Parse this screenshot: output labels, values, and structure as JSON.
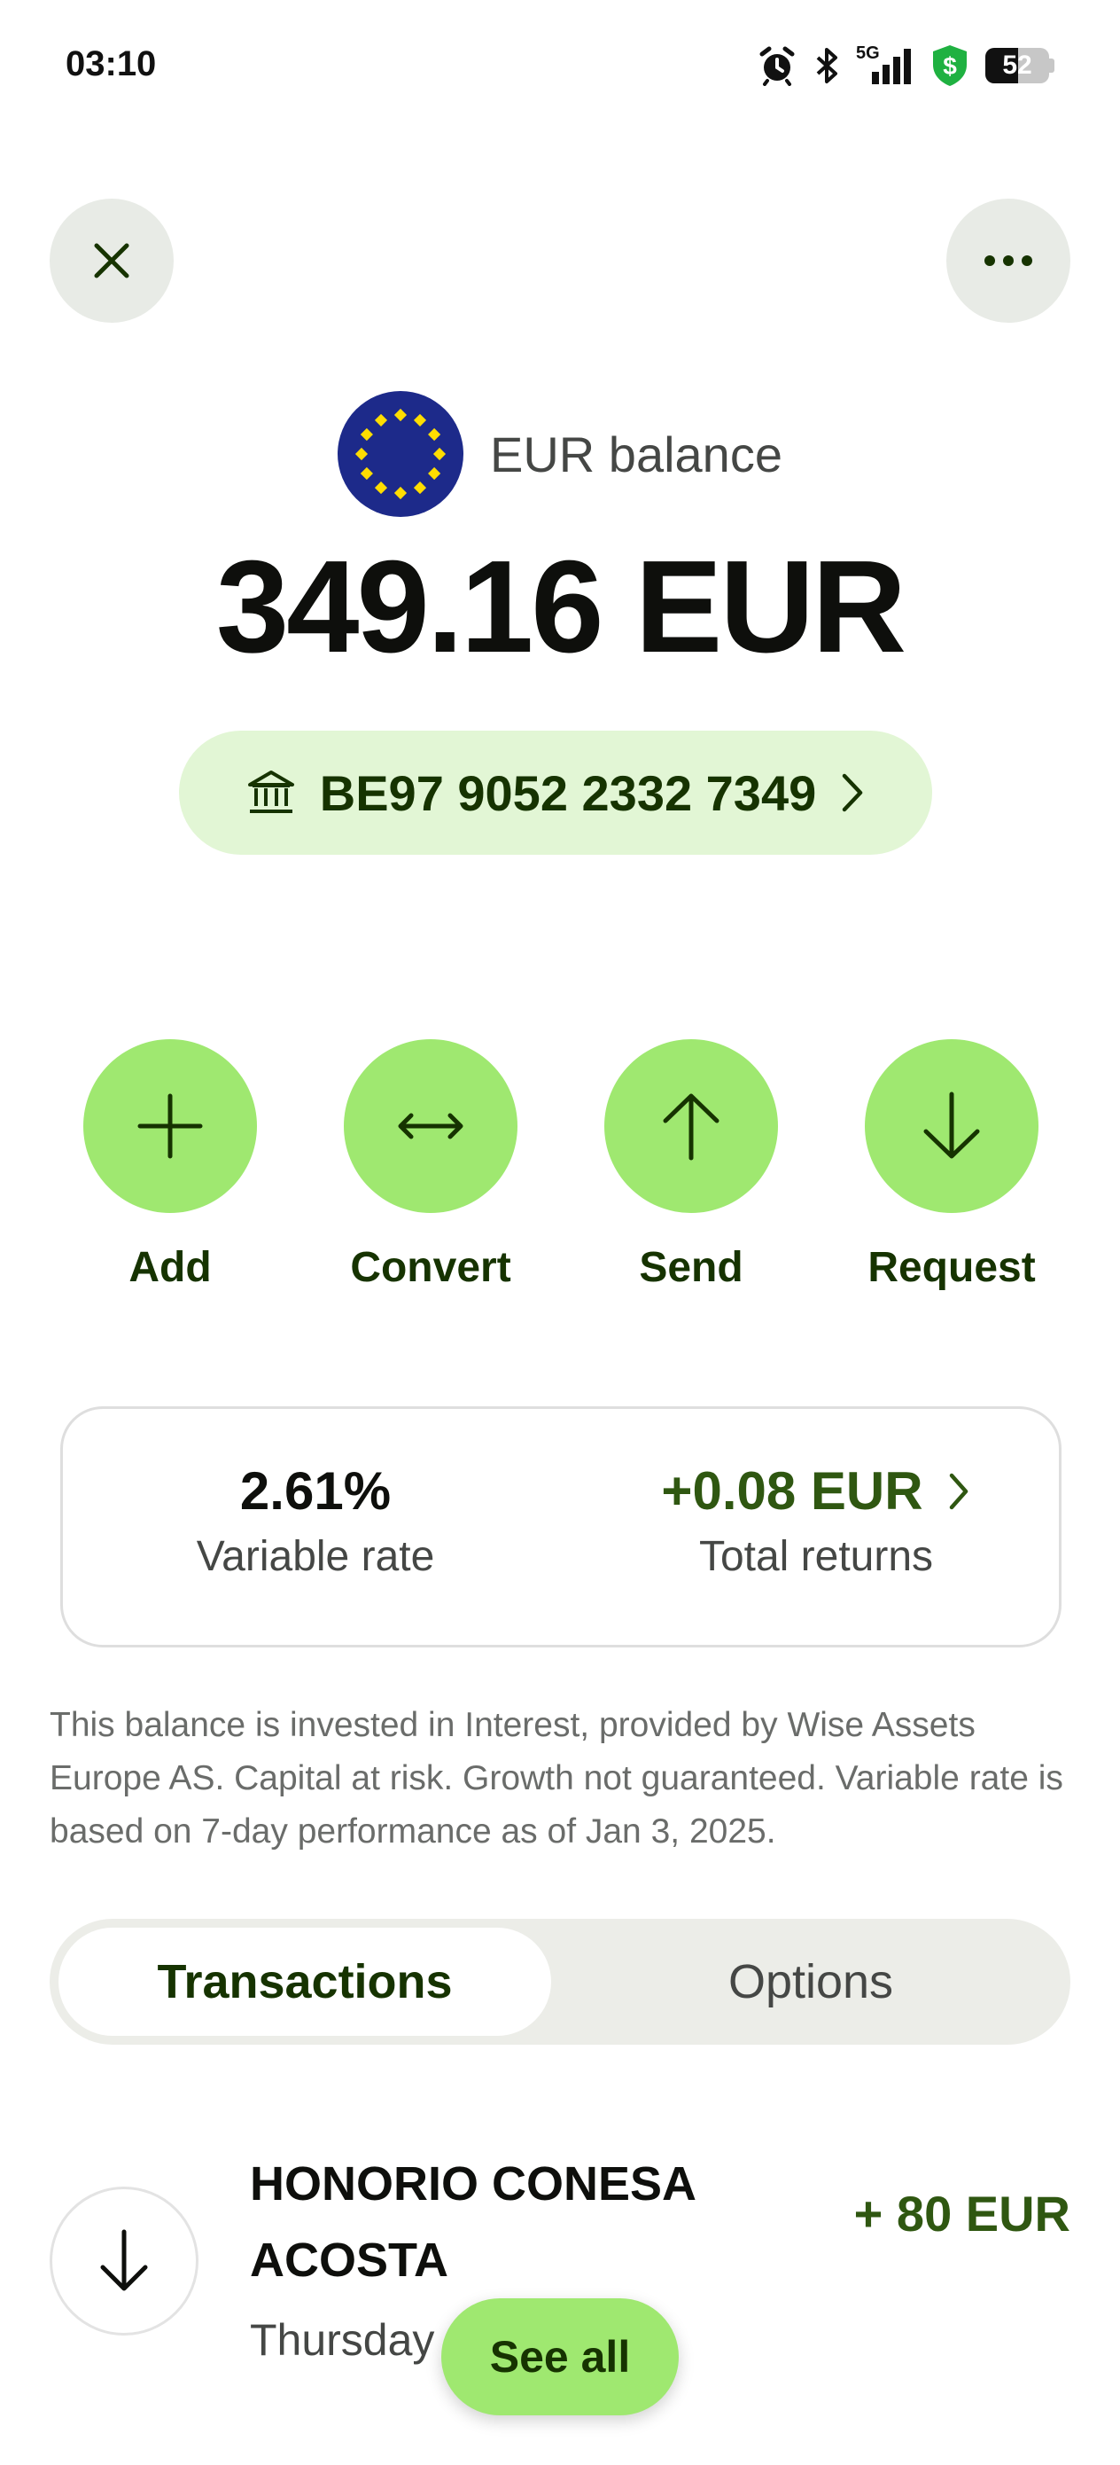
{
  "status_bar": {
    "time": "03:10",
    "network": "5G",
    "battery": "52",
    "battery_level": 0.52,
    "icons": [
      "alarm-icon",
      "bluetooth-icon",
      "signal-icon",
      "shield-dollar-icon",
      "battery-icon"
    ]
  },
  "header": {
    "close_icon": "close-icon",
    "more_icon": "more-icon"
  },
  "balance": {
    "flag_icon": "eu-flag-icon",
    "label": "EUR balance",
    "amount": "349.16 EUR"
  },
  "account": {
    "iban": "BE97 9052 2332 7349",
    "bank_icon": "bank-icon"
  },
  "actions": [
    {
      "label": "Add",
      "icon": "plus-icon"
    },
    {
      "label": "Convert",
      "icon": "convert-icon"
    },
    {
      "label": "Send",
      "icon": "arrow-up-icon"
    },
    {
      "label": "Request",
      "icon": "arrow-down-icon"
    }
  ],
  "interest": {
    "rate_value": "2.61%",
    "rate_label": "Variable rate",
    "returns_value": "+0.08 EUR",
    "returns_label": "Total returns"
  },
  "disclaimer": "This balance is invested in Interest, provided by Wise Assets Europe AS. Capital at risk. Growth not guaranteed. Variable rate is based on 7-day performance as of Jan 3, 2025.",
  "tabs": [
    {
      "label": "Transactions",
      "active": true
    },
    {
      "label": "Options",
      "active": false
    }
  ],
  "transactions": [
    {
      "name": "HONORIO CONESA ACOSTA",
      "date": "Thursday",
      "amount": "+ 80 EUR",
      "icon": "arrow-down-icon"
    }
  ],
  "see_all_label": "See all",
  "colors": {
    "accent": "#9fe870",
    "accent_dark": "#163300",
    "positive": "#2f5711",
    "pill_bg": "#e2f6d5",
    "neutral_btn": "#e8ebe6"
  }
}
